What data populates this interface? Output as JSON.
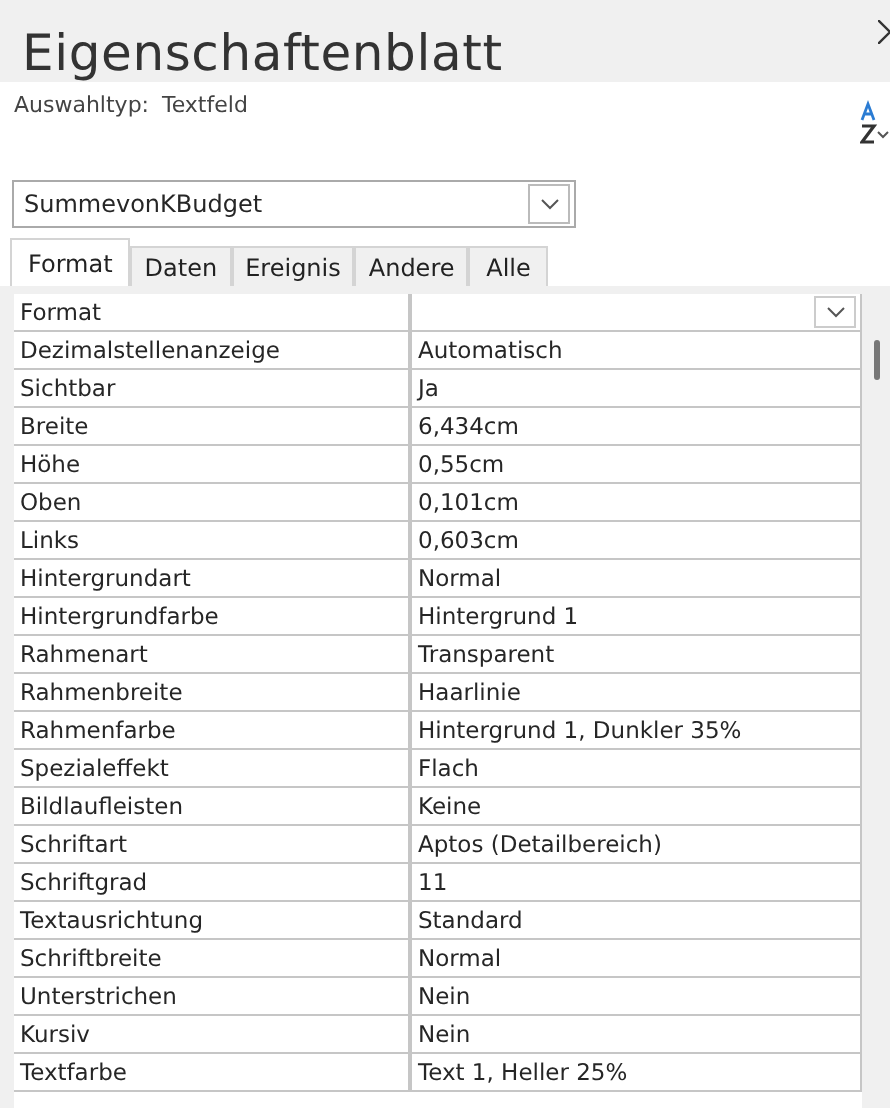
{
  "window": {
    "title": "Eigenschaftenblatt"
  },
  "selection_type": {
    "label": "Auswahltyp:",
    "value": "Textfeld"
  },
  "object_combo": {
    "value": "SummevonKBudget"
  },
  "tabs": [
    {
      "label": "Format",
      "selected": true
    },
    {
      "label": "Daten",
      "selected": false
    },
    {
      "label": "Ereignis",
      "selected": false
    },
    {
      "label": "Andere",
      "selected": false
    },
    {
      "label": "Alle",
      "selected": false
    }
  ],
  "properties": [
    {
      "name": "Format",
      "kind": "dropdown"
    },
    {
      "name": "Dezimalstellenanzeige",
      "value": "Automatisch",
      "kind": "text"
    },
    {
      "name": "Sichtbar",
      "value": "Ja",
      "kind": "text"
    },
    {
      "name": "Breite",
      "value": "6,434cm",
      "kind": "text"
    },
    {
      "name": "Höhe",
      "value": "0,55cm",
      "kind": "text"
    },
    {
      "name": "Oben",
      "value": "0,101cm",
      "kind": "text"
    },
    {
      "name": "Links",
      "value": "0,603cm",
      "kind": "text"
    },
    {
      "name": "Hintergrundart",
      "value": "Normal",
      "kind": "text"
    },
    {
      "name": "Hintergrundfarbe",
      "value": "Hintergrund 1",
      "kind": "text"
    },
    {
      "name": "Rahmenart",
      "value": "Transparent",
      "kind": "text"
    },
    {
      "name": "Rahmenbreite",
      "value": "Haarlinie",
      "kind": "text"
    },
    {
      "name": "Rahmenfarbe",
      "value": "Hintergrund 1, Dunkler 35%",
      "kind": "text"
    },
    {
      "name": "Spezialeffekt",
      "value": "Flach",
      "kind": "text"
    },
    {
      "name": "Bildlaufleisten",
      "value": "Keine",
      "kind": "text"
    },
    {
      "name": "Schriftart",
      "value": "Aptos (Detailbereich)",
      "kind": "text"
    },
    {
      "name": "Schriftgrad",
      "value": "11",
      "kind": "text"
    },
    {
      "name": "Textausrichtung",
      "value": "Standard",
      "kind": "text"
    },
    {
      "name": "Schriftbreite",
      "value": "Normal",
      "kind": "text"
    },
    {
      "name": "Unterstrichen",
      "value": "Nein",
      "kind": "text"
    },
    {
      "name": "Kursiv",
      "value": "Nein",
      "kind": "text"
    },
    {
      "name": "Textfarbe",
      "value": "Text 1, Heller 25%",
      "kind": "text"
    }
  ]
}
